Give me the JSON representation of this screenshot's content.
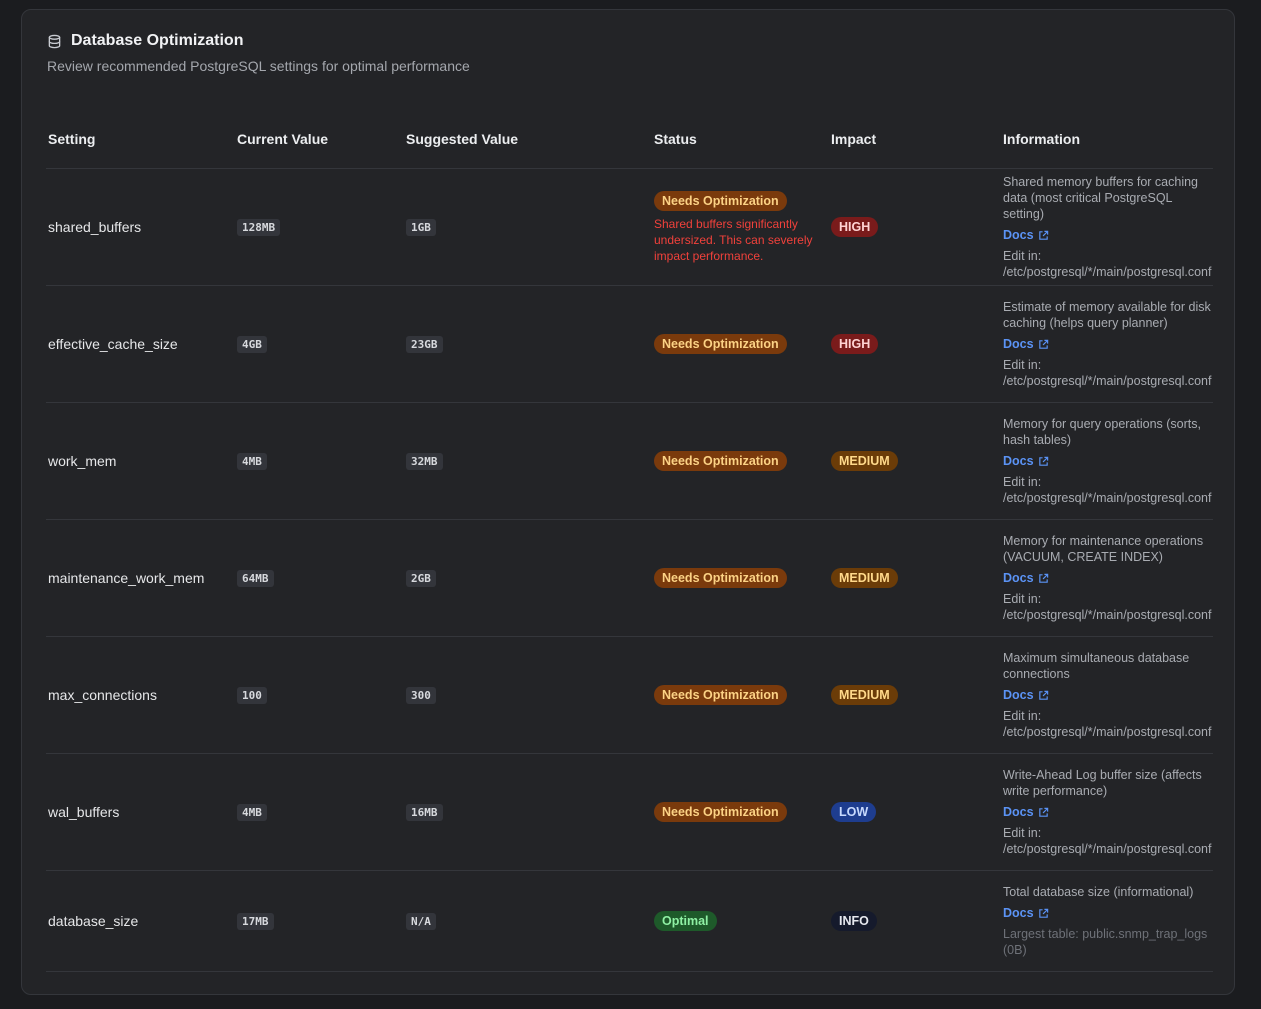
{
  "header": {
    "title": "Database Optimization",
    "subtitle": "Review recommended PostgreSQL settings for optimal performance",
    "icon": "database-icon"
  },
  "columns": {
    "setting": "Setting",
    "current": "Current Value",
    "suggested": "Suggested Value",
    "status": "Status",
    "impact": "Impact",
    "information": "Information"
  },
  "rows": [
    {
      "setting": "shared_buffers",
      "current": "128MB",
      "suggested": "1GB",
      "status": "Needs Optimization",
      "status_note": "Shared buffers significantly undersized. This can severely impact performance.",
      "impact": "HIGH",
      "desc": "Shared memory buffers for caching data (most critical PostgreSQL setting)",
      "docs": "Docs",
      "edit_label": "Edit in:",
      "edit_path": "/etc/postgresql/*/main/postgresql.conf"
    },
    {
      "setting": "effective_cache_size",
      "current": "4GB",
      "suggested": "23GB",
      "status": "Needs Optimization",
      "impact": "HIGH",
      "desc": "Estimate of memory available for disk caching (helps query planner)",
      "docs": "Docs",
      "edit_label": "Edit in:",
      "edit_path": "/etc/postgresql/*/main/postgresql.conf"
    },
    {
      "setting": "work_mem",
      "current": "4MB",
      "suggested": "32MB",
      "status": "Needs Optimization",
      "impact": "MEDIUM",
      "desc": "Memory for query operations (sorts, hash tables)",
      "docs": "Docs",
      "edit_label": "Edit in:",
      "edit_path": "/etc/postgresql/*/main/postgresql.conf"
    },
    {
      "setting": "maintenance_work_mem",
      "current": "64MB",
      "suggested": "2GB",
      "status": "Needs Optimization",
      "impact": "MEDIUM",
      "desc": "Memory for maintenance operations (VACUUM, CREATE INDEX)",
      "docs": "Docs",
      "edit_label": "Edit in:",
      "edit_path": "/etc/postgresql/*/main/postgresql.conf"
    },
    {
      "setting": "max_connections",
      "current": "100",
      "suggested": "300",
      "status": "Needs Optimization",
      "impact": "MEDIUM",
      "desc": "Maximum simultaneous database connections",
      "docs": "Docs",
      "edit_label": "Edit in:",
      "edit_path": "/etc/postgresql/*/main/postgresql.conf"
    },
    {
      "setting": "wal_buffers",
      "current": "4MB",
      "suggested": "16MB",
      "status": "Needs Optimization",
      "impact": "LOW",
      "desc": "Write-Ahead Log buffer size (affects write performance)",
      "docs": "Docs",
      "edit_label": "Edit in:",
      "edit_path": "/etc/postgresql/*/main/postgresql.conf"
    },
    {
      "setting": "database_size",
      "current": "17MB",
      "suggested": "N/A",
      "status": "Optimal",
      "impact": "INFO",
      "desc": "Total database size (informational)",
      "docs": "Docs",
      "largest_table": "Largest table: public.snmp_trap_logs (0B)"
    }
  ],
  "colors": {
    "background": "#1b1c1f",
    "card": "#232427",
    "link": "#5b93f5",
    "error_text": "#f0413b",
    "needs_optimization_bg": "#7a3a0c",
    "optimal_bg": "#1e5a2a",
    "high_bg": "#7a1b1b",
    "medium_bg": "#6b3c08",
    "low_bg": "#1e3d8f",
    "info_bg": "#151a2c"
  }
}
